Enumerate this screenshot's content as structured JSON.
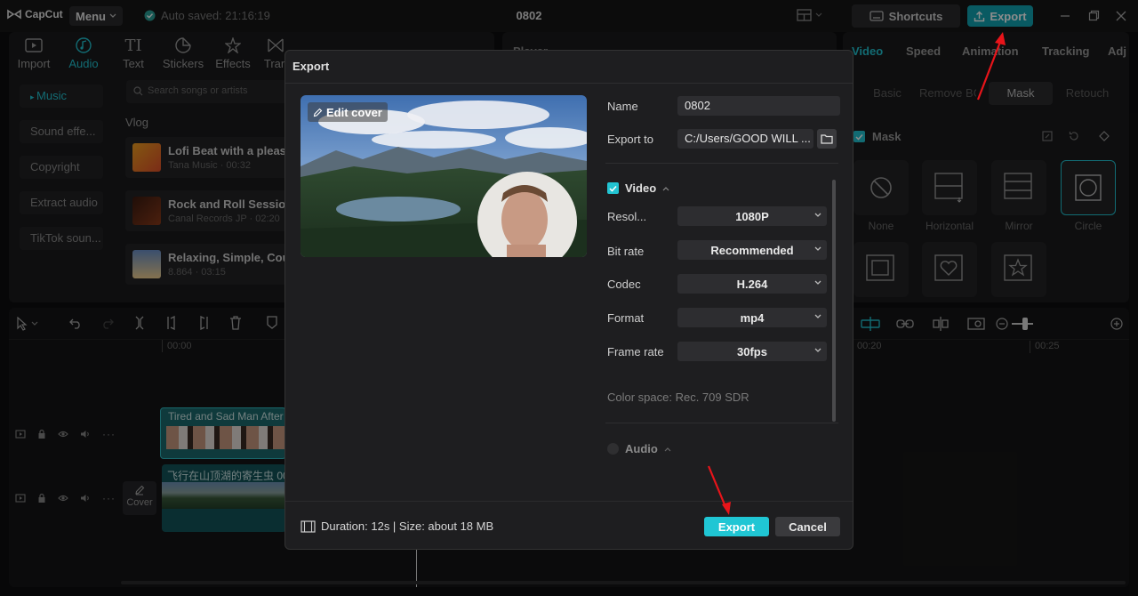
{
  "app": {
    "logo": "CapCut",
    "menu_label": "Menu",
    "autosave": "Auto saved: 21:16:19",
    "project_title": "0802",
    "shortcuts_label": "Shortcuts",
    "export_label": "Export"
  },
  "toolbar": {
    "items": [
      "Import",
      "Audio",
      "Text",
      "Stickers",
      "Effects",
      "Tran"
    ]
  },
  "audio_sidebar": {
    "items": [
      "Music",
      "Sound effe...",
      "Copyright",
      "Extract audio",
      "TikTok soun..."
    ]
  },
  "music": {
    "search_placeholder": "Search songs or artists",
    "category": "Vlog",
    "tracks": [
      {
        "title": "Lofi Beat with a pleasa",
        "subtitle": "Tana Music · 00:32"
      },
      {
        "title": "Rock and Roll Session",
        "subtitle": "Canal Records JP · 02:20"
      },
      {
        "title": "Relaxing, Simple, Cou",
        "subtitle": "8.864 · 03:15"
      }
    ]
  },
  "player": {
    "title": "Player"
  },
  "right_panel": {
    "tabs": [
      "Video",
      "Speed",
      "Animation",
      "Tracking",
      "Adj"
    ],
    "subtabs": [
      "Basic",
      "Remove BG",
      "Mask",
      "Retouch"
    ],
    "mask_title": "Mask",
    "masks": [
      "None",
      "Horizontal",
      "Mirror",
      "Circle"
    ]
  },
  "timeline": {
    "ticks": [
      "00:00",
      "00:20",
      "00:25"
    ],
    "clip_overlay": "Tired and Sad Man After",
    "clip_main": "飞行在山顶湖的寄生虫",
    "clip_main_suffix": "00",
    "cover_label": "Cover"
  },
  "export_dialog": {
    "title": "Export",
    "edit_cover": "Edit cover",
    "name_label": "Name",
    "name_value": "0802",
    "export_to_label": "Export to",
    "export_to_value": "C:/Users/GOOD WILL ...",
    "video_section": "Video",
    "resolution_label": "Resol...",
    "resolution_value": "1080P",
    "bitrate_label": "Bit rate",
    "bitrate_value": "Recommended",
    "codec_label": "Codec",
    "codec_value": "H.264",
    "format_label": "Format",
    "format_value": "mp4",
    "framerate_label": "Frame rate",
    "framerate_value": "30fps",
    "color_space": "Color space: Rec. 709 SDR",
    "audio_section": "Audio",
    "footer_info": "Duration: 12s | Size: about 18 MB",
    "export_button": "Export",
    "cancel_button": "Cancel"
  },
  "colors": {
    "accent": "#22c4d2",
    "export_top": "#12a4b3",
    "annotation_arrow": "#e8141a"
  }
}
